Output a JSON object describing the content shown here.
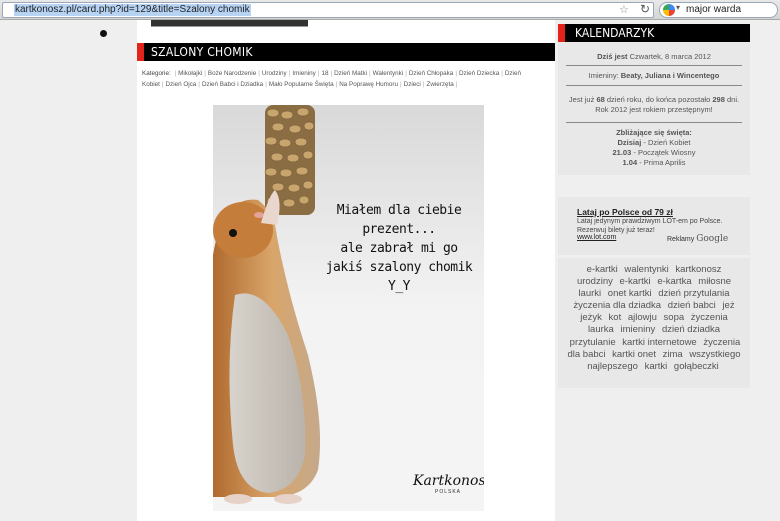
{
  "browser": {
    "url": "kartkonosz.pl/card.php?id=129&title=Szalony chomik",
    "search_value": "major warda"
  },
  "card": {
    "title": "SZALONY CHOMIK",
    "categories_label": "Kategorie:",
    "categories": [
      "Mikołajki",
      "Boże Narodzenie",
      "Urodziny",
      "Imieniny",
      "18",
      "Dzień Matki",
      "Walentynki",
      "Dzień Chłopaka",
      "Dzień Dziecka",
      "Dzień Kobiet",
      "Dzień Ojca",
      "Dzień Babci i Dziadka",
      "Mało Popularne Święta",
      "Na Poprawę Humoru",
      "Dzieci",
      "Zwierzęta"
    ],
    "message_lines": [
      "Miałem dla ciebie prezent...",
      "ale zabrał mi go",
      "jakiś szalony chomik",
      "Y_Y"
    ],
    "logo_text": "Kartkonosz",
    "logo_sub": "POLSKA"
  },
  "calendar": {
    "title": "KALENDARZYK",
    "today_label": "Dziś jest",
    "today_value": "Czwartek, 8 marca 2012",
    "nameday_label": "Imieniny:",
    "nameday_value": "Beaty, Juliana i Wincentego",
    "day_text_1": "Jest już",
    "day_number": "68",
    "day_text_2": "dzień roku, do końca pozostało",
    "days_left": "298",
    "day_text_3": "dni. Rok 2012 jest rokiem przestępnym!",
    "upcoming_title": "Zbliżające się święta:",
    "holidays": [
      {
        "date": "Dzisiaj",
        "name": "Dzień Kobiet"
      },
      {
        "date": "21.03",
        "name": "Początek Wiosny"
      },
      {
        "date": "1.04",
        "name": "Prima Aprilis"
      }
    ]
  },
  "ad": {
    "title": "Lataj po Polsce od 79 zł",
    "description": "Lataj jedynym prawdziwym LOT-em po Polsce. Rezerwuj bilety już teraz!",
    "url": "www.lot.com",
    "google_label": "Reklamy",
    "google_brand": "Google"
  },
  "tags": [
    "e-kartki",
    "walentynki",
    "kartkonosz",
    "urodziny",
    "e-kartki",
    "e-kartka",
    "miłosne",
    "laurki",
    "onet kartki",
    "dzień przytulania",
    "życzenia dla dziadka",
    "dzień babci",
    "jeż",
    "jeżyk",
    "kot",
    "ajlowju",
    "sopa",
    "życzenia",
    "laurka",
    "imieniny",
    "dzień dziadka",
    "przytulanie",
    "kartki internetowe",
    "życzenia dla babci",
    "kartki onet",
    "zima",
    "wszystkiego najlepszego",
    "kartki",
    "gołąbeczki"
  ],
  "colors": {
    "accent_red": "#e4231a",
    "title_bar": "#000000"
  }
}
